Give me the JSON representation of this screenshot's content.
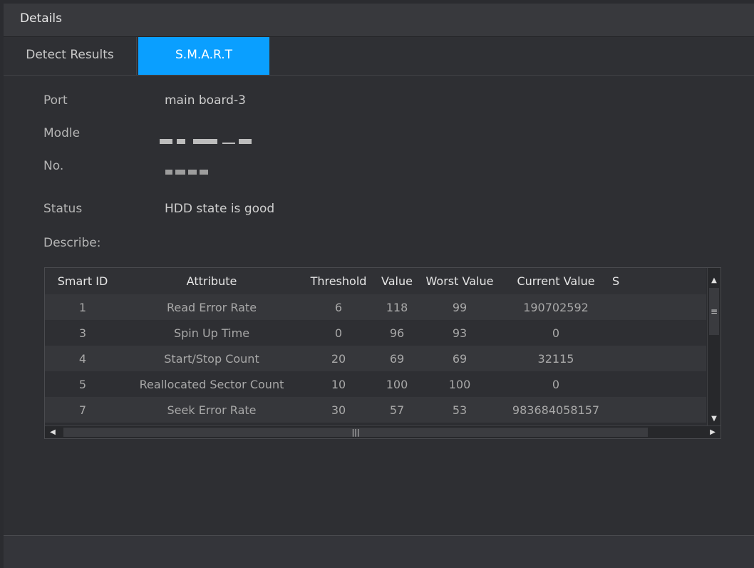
{
  "window": {
    "title": "Details"
  },
  "tabs": [
    {
      "label": "Detect Results",
      "active": false
    },
    {
      "label": "S.M.A.R.T",
      "active": true
    }
  ],
  "info": {
    "port": {
      "label": "Port",
      "value": "main board-3"
    },
    "model": {
      "label": "Modle",
      "value": ""
    },
    "number": {
      "label": "No.",
      "value": ""
    },
    "status": {
      "label": "Status",
      "value": "HDD state is good"
    },
    "describe": {
      "label": "Describe:"
    }
  },
  "table": {
    "columns": [
      "Smart ID",
      "Attribute",
      "Threshold",
      "Value",
      "Worst Value",
      "Current Value",
      "S"
    ],
    "rows": [
      [
        "1",
        "Read Error Rate",
        "6",
        "118",
        "99",
        "190702592"
      ],
      [
        "3",
        "Spin Up Time",
        "0",
        "96",
        "93",
        "0"
      ],
      [
        "4",
        "Start/Stop Count",
        "20",
        "69",
        "69",
        "32115"
      ],
      [
        "5",
        "Reallocated Sector Count",
        "10",
        "100",
        "100",
        "0"
      ],
      [
        "7",
        "Seek Error Rate",
        "30",
        "57",
        "53",
        "983684058157"
      ]
    ]
  },
  "colors": {
    "accent": "#0a9fff",
    "background": "#2e2f33"
  }
}
